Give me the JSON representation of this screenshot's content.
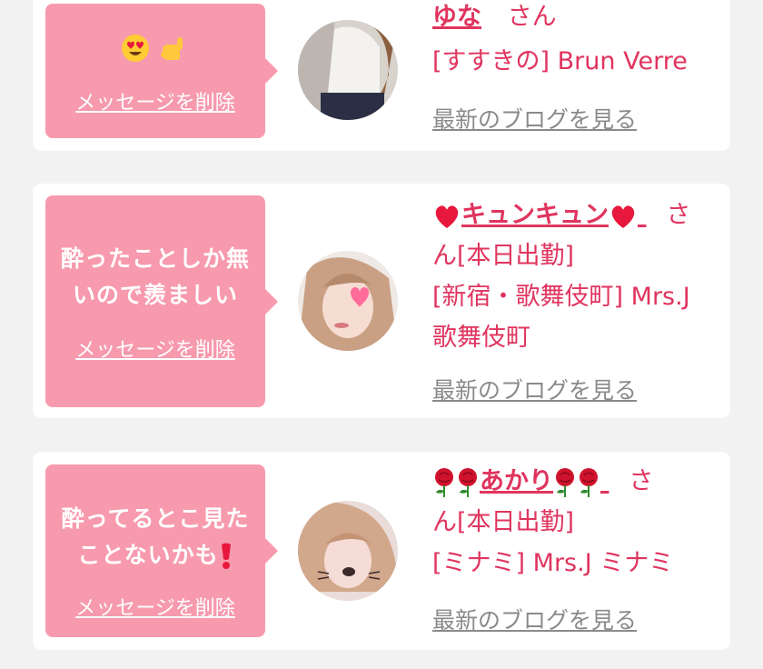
{
  "cards": [
    {
      "message": "",
      "message_emojis": [
        "heart-eyes-emoji",
        "call-me-hand-emoji"
      ],
      "delete_label": "メッセージを削除",
      "name": "ゆな",
      "honorific": "さん",
      "status": "",
      "shop": "[すすきの] Brun Verre",
      "blog_label": "最新のブログを見る",
      "avatar": "photo-avatar"
    },
    {
      "message_line1": "酔ったことしか無",
      "message_line2": "いので羨ましい",
      "delete_label": "メッセージを削除",
      "name": "キュンキュン",
      "name_decoration": "red-heart-emoji",
      "honorific": "さ",
      "name_wrap": "ん[本日出勤]",
      "shop_line1": "[新宿・歌舞伎町] Mrs.J",
      "shop_line2": "歌舞伎町",
      "blog_label": "最新のブログを見る",
      "avatar": "photo-avatar"
    },
    {
      "message_line1": "酔ってるとこ見た",
      "message_line2": "ことないかも",
      "message_emoji": "red-exclamation-emoji",
      "delete_label": "メッセージを削除",
      "name": "あかり",
      "name_decoration": "rose-emoji",
      "honorific": "さ",
      "name_wrap": "ん[本日出勤]",
      "shop": "[ミナミ] Mrs.J ミナミ",
      "blog_label": "最新のブログを見る",
      "avatar": "photo-avatar"
    }
  ],
  "colors": {
    "background": "#f2f2f2",
    "card": "#ffffff",
    "bubble": "#f79aad",
    "accent": "#e0345e",
    "muted_link": "#8a8a8a"
  }
}
